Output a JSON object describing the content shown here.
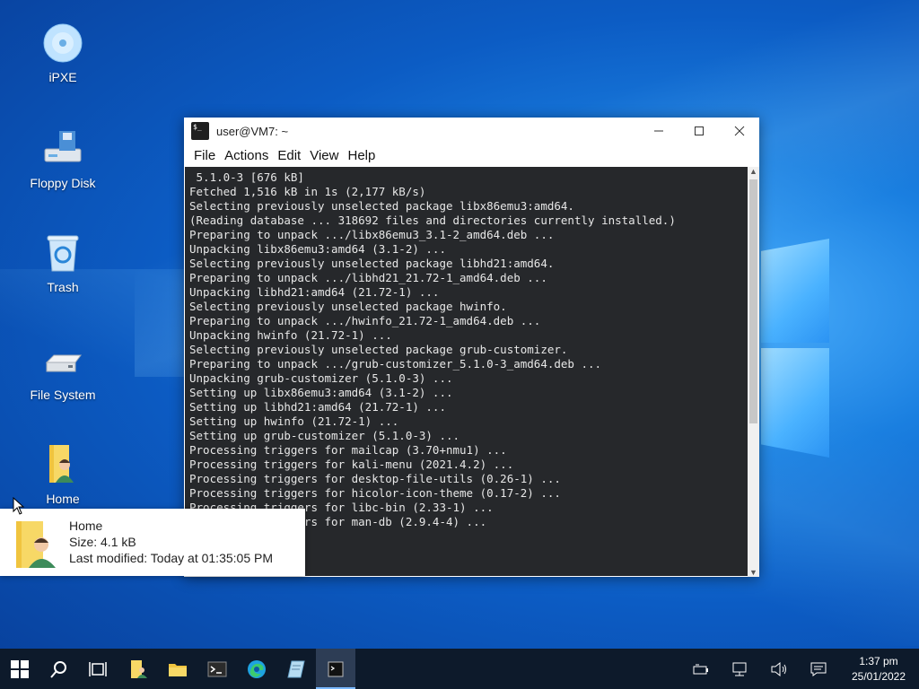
{
  "desktop": {
    "icons": [
      {
        "label": "iPXE"
      },
      {
        "label": "Floppy Disk"
      },
      {
        "label": "Trash"
      },
      {
        "label": "File System"
      },
      {
        "label": "Home"
      }
    ]
  },
  "terminal": {
    "title": "user@VM7: ~",
    "menu": [
      "File",
      "Actions",
      "Edit",
      "View",
      "Help"
    ],
    "output": " 5.1.0-3 [676 kB]\nFetched 1,516 kB in 1s (2,177 kB/s)\nSelecting previously unselected package libx86emu3:amd64.\n(Reading database ... 318692 files and directories currently installed.)\nPreparing to unpack .../libx86emu3_3.1-2_amd64.deb ...\nUnpacking libx86emu3:amd64 (3.1-2) ...\nSelecting previously unselected package libhd21:amd64.\nPreparing to unpack .../libhd21_21.72-1_amd64.deb ...\nUnpacking libhd21:amd64 (21.72-1) ...\nSelecting previously unselected package hwinfo.\nPreparing to unpack .../hwinfo_21.72-1_amd64.deb ...\nUnpacking hwinfo (21.72-1) ...\nSelecting previously unselected package grub-customizer.\nPreparing to unpack .../grub-customizer_5.1.0-3_amd64.deb ...\nUnpacking grub-customizer (5.1.0-3) ...\nSetting up libx86emu3:amd64 (3.1-2) ...\nSetting up libhd21:amd64 (21.72-1) ...\nSetting up hwinfo (21.72-1) ...\nSetting up grub-customizer (5.1.0-3) ...\nProcessing triggers for mailcap (3.70+nmu1) ...\nProcessing triggers for kali-menu (2021.4.2) ...\nProcessing triggers for desktop-file-utils (0.26-1) ...\nProcessing triggers for hicolor-icon-theme (0.17-2) ...\nProcessing triggers for libc-bin (2.33-1) ...\nProcessing triggers for man-db (2.9.4-4) ..."
  },
  "tooltip": {
    "name": "Home",
    "size": "Size: 4.1 kB",
    "modified": "Last modified: Today at 01:35:05 PM"
  },
  "taskbar": {
    "time": "1:37 pm",
    "date": "25/01/2022"
  },
  "colors": {
    "taskbar": "#0d1a2b",
    "terminal_bg": "#26282b",
    "accent": "#7ab8ff"
  }
}
